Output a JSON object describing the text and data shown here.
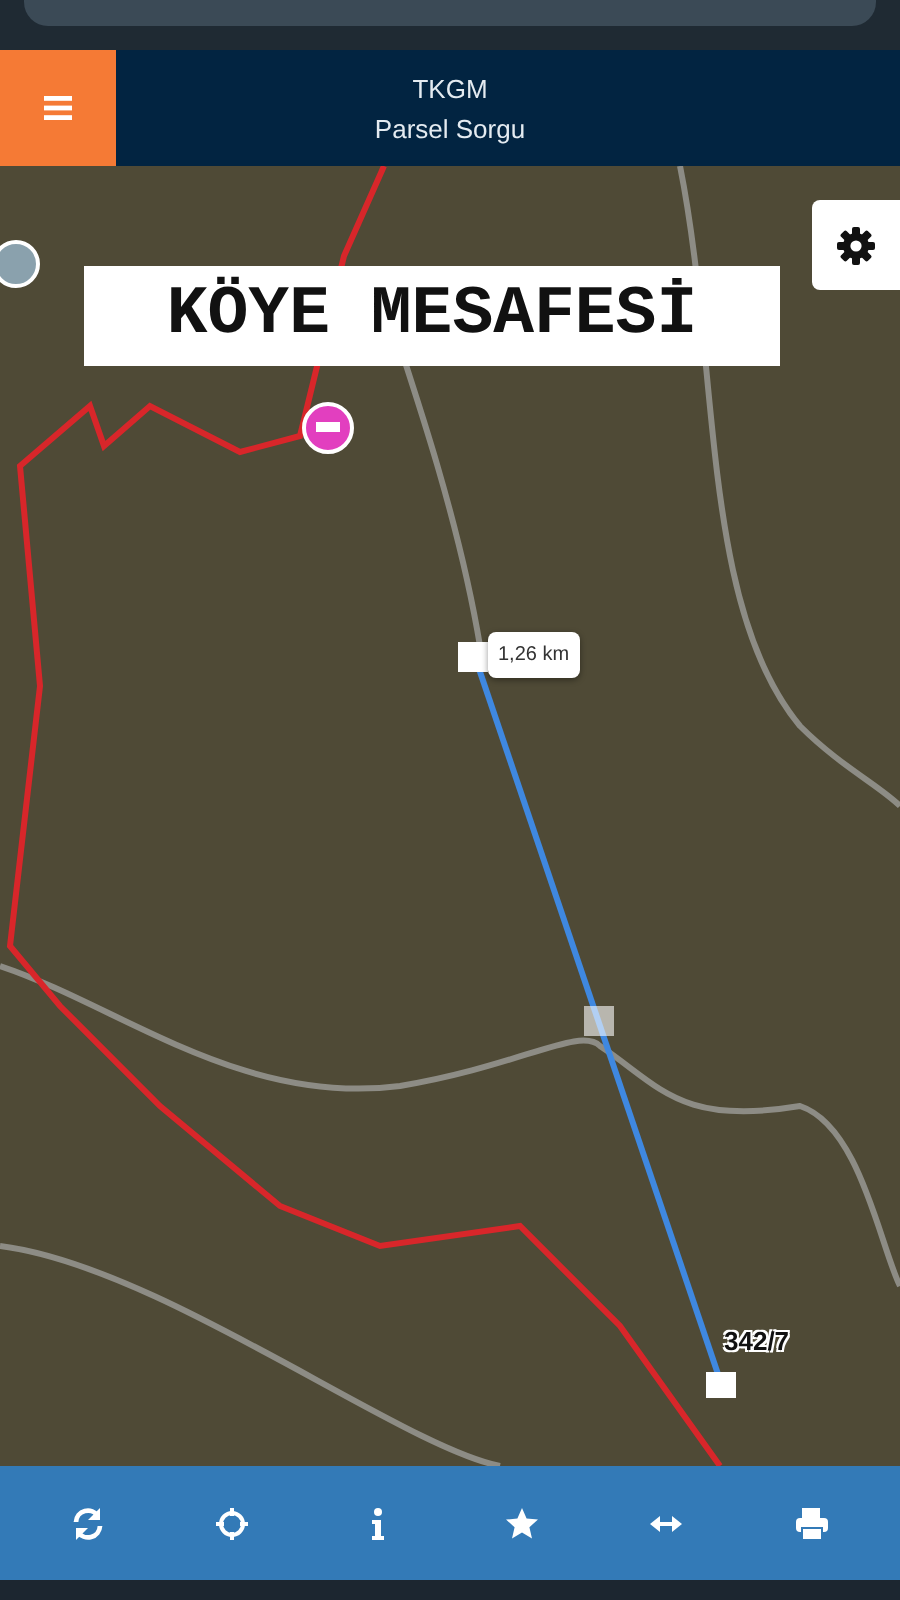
{
  "header": {
    "title": "TKGM",
    "subtitle": "Parsel Sorgu"
  },
  "map": {
    "banner": "KÖYE MESAFESİ",
    "measure_label": "1,26 km",
    "parcel_label": "342/7"
  },
  "toolbar": [
    {
      "kind": "refresh"
    },
    {
      "kind": "locate"
    },
    {
      "kind": "info"
    },
    {
      "kind": "star"
    },
    {
      "kind": "measure"
    },
    {
      "kind": "print"
    }
  ]
}
